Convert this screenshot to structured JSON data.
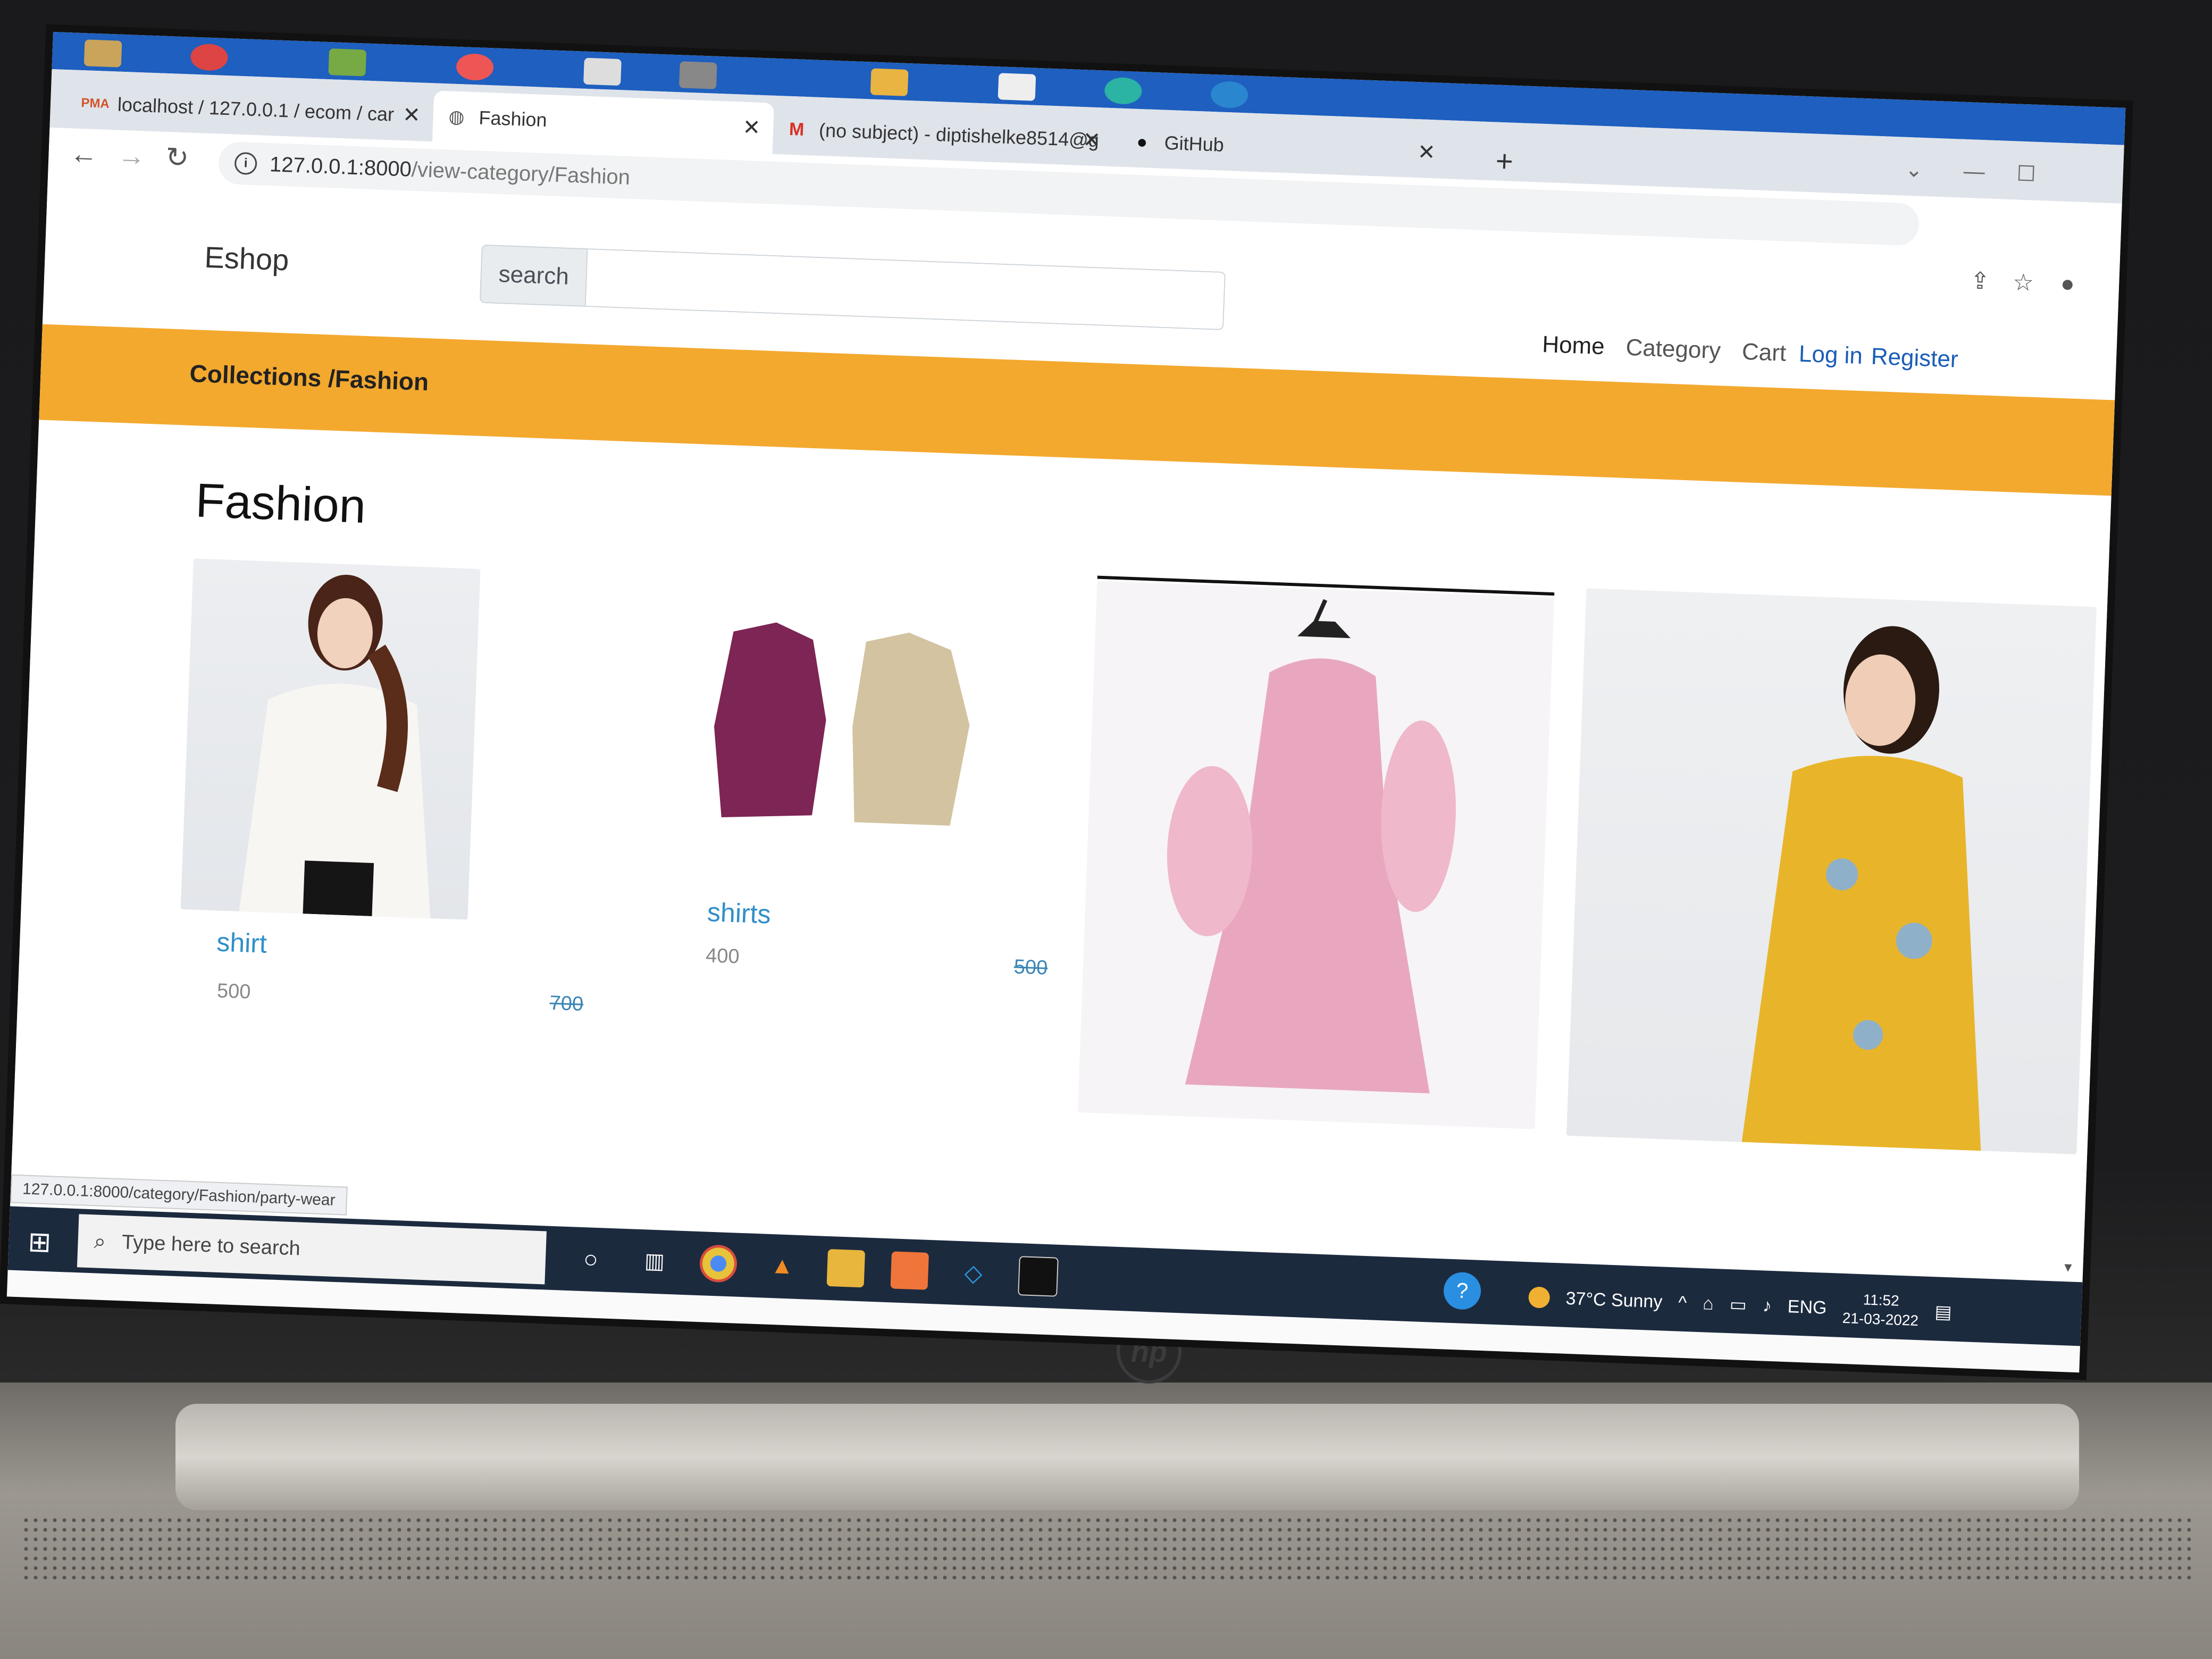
{
  "browser": {
    "tabs": [
      {
        "title": "localhost / 127.0.0.1 / ecom / car",
        "icon": "phpmyadmin-icon",
        "active": false
      },
      {
        "title": "Fashion",
        "icon": "globe-icon",
        "active": true
      },
      {
        "title": "(no subject) - diptishelke8514@g",
        "icon": "gmail-icon",
        "active": false
      },
      {
        "title": "GitHub",
        "icon": "github-icon",
        "active": false
      }
    ],
    "url_host": "127.0.0.1:8000",
    "url_path": "/view-category/Fashion",
    "status_url": "127.0.0.1:8000/category/Fashion/party-wear"
  },
  "header": {
    "brand": "Eshop",
    "search_label": "search",
    "search_value": "",
    "nav": {
      "home": "Home",
      "category": "Category",
      "cart": "Cart",
      "login": "Log in",
      "register": "Register"
    }
  },
  "breadcrumb": "Collections /Fashion",
  "category_title": "Fashion",
  "products": [
    {
      "name": "shirt",
      "selling_price": "500",
      "original_price": "700"
    },
    {
      "name": "shirts",
      "selling_price": "400",
      "original_price": "500"
    }
  ],
  "taskbar": {
    "search_placeholder": "Type here to search",
    "weather": "37°C  Sunny",
    "language": "ENG",
    "time": "11:52",
    "date": "21-03-2022"
  },
  "colors": {
    "accent_bar": "#f3a92e",
    "link_blue": "#2f8fc9",
    "taskbar": "#1c2a3e"
  }
}
